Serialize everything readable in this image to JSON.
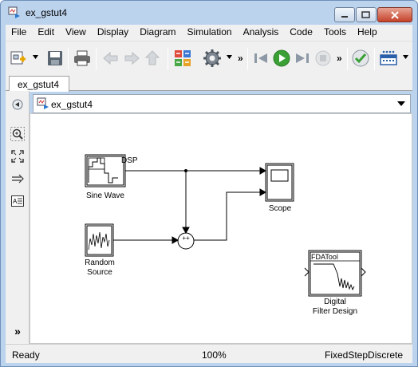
{
  "window": {
    "title": "ex_gstut4"
  },
  "menu": [
    "File",
    "Edit",
    "View",
    "Display",
    "Diagram",
    "Simulation",
    "Analysis",
    "Code",
    "Tools",
    "Help"
  ],
  "tabs": [
    {
      "label": "ex_gstut4"
    }
  ],
  "address": {
    "path": "ex_gstut4"
  },
  "toolbar": {
    "icons": [
      "new-model-icon",
      "save-icon",
      "print-icon",
      "back-icon",
      "forward-icon",
      "up-icon",
      "library-browser-icon",
      "model-settings-icon",
      "step-back-icon",
      "run-icon",
      "step-forward-icon",
      "stop-icon",
      "build-icon",
      "update-diagram-icon"
    ],
    "more": "»"
  },
  "palette": {
    "icons": [
      "hide-explorer-icon",
      "zoom-icon",
      "fit-view-icon",
      "signal-arrow-icon",
      "annotation-icon",
      "expand-icon"
    ],
    "expand": "»"
  },
  "blocks": {
    "sine_wave": {
      "label": "Sine Wave",
      "badge": "DSP"
    },
    "random_source": {
      "label_line1": "Random",
      "label_line2": "Source"
    },
    "scope": {
      "label": "Scope"
    },
    "sum": {
      "signs": "++"
    },
    "filter": {
      "badge": "FDATool",
      "label_line1": "Digital",
      "label_line2": "Filter Design"
    }
  },
  "status": {
    "state": "Ready",
    "zoom": "100%",
    "solver": "FixedStepDiscrete"
  },
  "colors": {
    "titlebar": "#bcd3ee",
    "run_green": "#3aa035",
    "toolbar_bg": "#f0f0f0"
  }
}
